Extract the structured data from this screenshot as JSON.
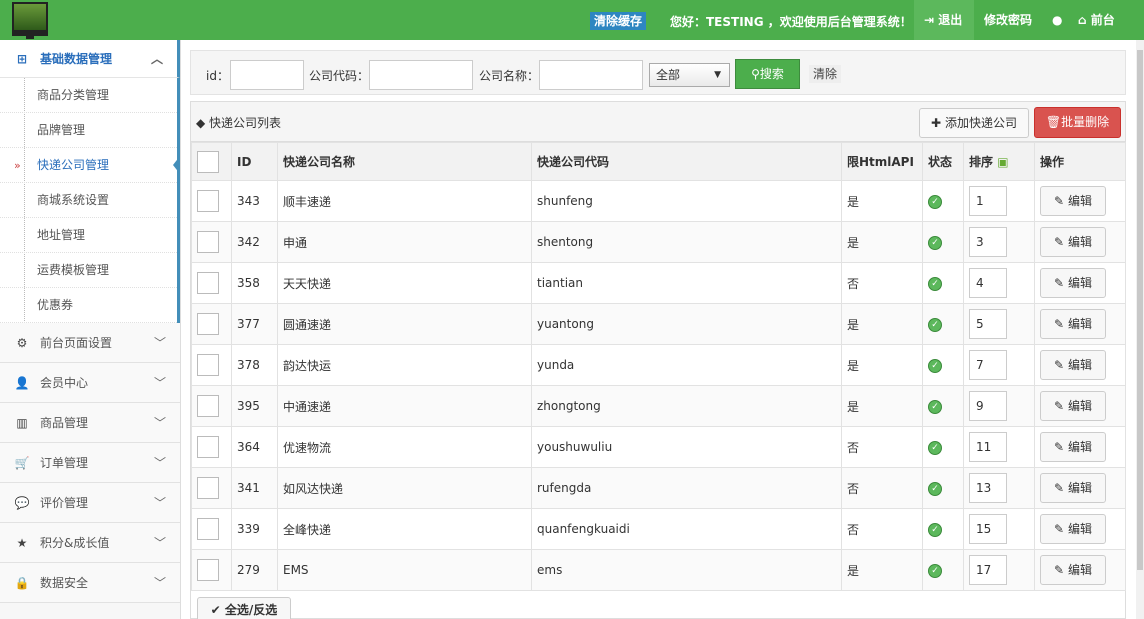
{
  "topbar": {
    "clear_cache": "清除缓存",
    "greeting": "您好：TESTING ，欢迎使用后台管理系统！",
    "logout": "退出",
    "change_password": "修改密码",
    "front": "前台",
    "accent": "#4cae4c"
  },
  "sidebar": {
    "active_group": "基础数据管理",
    "subitems": [
      "商品分类管理",
      "品牌管理",
      "快递公司管理",
      "商城系统设置",
      "地址管理",
      "运费模板管理",
      "优惠券"
    ],
    "active_sub": "快递公司管理",
    "groups": [
      {
        "label": "前台页面设置",
        "icon": "gears-icon"
      },
      {
        "label": "会员中心",
        "icon": "user-icon"
      },
      {
        "label": "商品管理",
        "icon": "barcode-icon"
      },
      {
        "label": "订单管理",
        "icon": "cart-icon"
      },
      {
        "label": "评价管理",
        "icon": "comments-icon"
      },
      {
        "label": "积分&成长值",
        "icon": "star-icon"
      },
      {
        "label": "数据安全",
        "icon": "lock-icon"
      }
    ]
  },
  "search": {
    "id_label": "id：",
    "code_label": "公司代码：",
    "name_label": "公司名称：",
    "select_value": "全部",
    "search_button": "搜索",
    "clear_button": "清除"
  },
  "panel": {
    "title": "快递公司列表",
    "add_button": "添加快递公司",
    "batch_delete": "批量删除",
    "select_all": "全选/反选"
  },
  "table": {
    "headers": [
      "ID",
      "快递公司名称",
      "快递公司代码",
      "限HtmlAPI",
      "状态",
      "排序",
      "操作"
    ],
    "edit_label": "编辑",
    "rows": [
      {
        "id": "343",
        "name": "顺丰速递",
        "code": "shunfeng",
        "api": "是",
        "sort": "1"
      },
      {
        "id": "342",
        "name": "申通",
        "code": "shentong",
        "api": "是",
        "sort": "3"
      },
      {
        "id": "358",
        "name": "天天快递",
        "code": "tiantian",
        "api": "否",
        "sort": "4"
      },
      {
        "id": "377",
        "name": "圆通速递",
        "code": "yuantong",
        "api": "是",
        "sort": "5"
      },
      {
        "id": "378",
        "name": "韵达快运",
        "code": "yunda",
        "api": "是",
        "sort": "7"
      },
      {
        "id": "395",
        "name": "中通速递",
        "code": "zhongtong",
        "api": "是",
        "sort": "9"
      },
      {
        "id": "364",
        "name": "优速物流",
        "code": "youshuwuliu",
        "api": "否",
        "sort": "11"
      },
      {
        "id": "341",
        "name": "如风达快递",
        "code": "rufengda",
        "api": "否",
        "sort": "13"
      },
      {
        "id": "339",
        "name": "全峰快递",
        "code": "quanfengkuaidi",
        "api": "否",
        "sort": "15"
      },
      {
        "id": "279",
        "name": "EMS",
        "code": "ems",
        "api": "是",
        "sort": "17"
      }
    ]
  }
}
